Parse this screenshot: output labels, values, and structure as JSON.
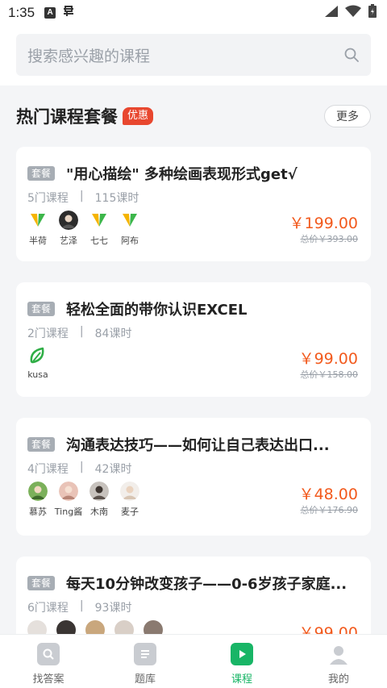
{
  "status_bar": {
    "time": "1:35",
    "a_icon_letter": "A"
  },
  "search": {
    "placeholder": "搜索感兴趣的课程"
  },
  "section": {
    "title": "热门课程套餐",
    "badge": "优惠",
    "more_label": "更多"
  },
  "colors": {
    "accent": "#18b566",
    "price": "#f25a1d",
    "hot_badge": "#e8472f",
    "tag": "#a7adb4"
  },
  "packages": [
    {
      "tag": "套餐",
      "title": "\"用心描绘\" 多种绘画表现形式get√",
      "course_count": "5门课程",
      "separator": "|",
      "hours": "115课时",
      "price": "￥199.00",
      "original_price": "总价￥393.00",
      "teachers": [
        {
          "name": "半荷",
          "icon": "leaf-logo-icon"
        },
        {
          "name": "艺泽",
          "icon": "avatar-photo"
        },
        {
          "name": "七七",
          "icon": "leaf-logo-icon"
        },
        {
          "name": "阿布",
          "icon": "leaf-logo-icon"
        }
      ]
    },
    {
      "tag": "套餐",
      "title": "轻松全面的带你认识EXCEL",
      "course_count": "2门课程",
      "separator": "|",
      "hours": "84课时",
      "price": "￥99.00",
      "original_price": "总价￥158.00",
      "teachers": [
        {
          "name": "kusa",
          "icon": "green-leaf-icon"
        }
      ]
    },
    {
      "tag": "套餐",
      "title": "沟通表达技巧——如何让自己表达出口...",
      "course_count": "4门课程",
      "separator": "|",
      "hours": "42课时",
      "price": "￥48.00",
      "original_price": "总价￥176.90",
      "teachers": [
        {
          "name": "慕苏",
          "icon": "avatar-photo"
        },
        {
          "name": "Ting酱",
          "icon": "avatar-photo"
        },
        {
          "name": "木南",
          "icon": "avatar-photo"
        },
        {
          "name": "麦子",
          "icon": "avatar-photo"
        }
      ]
    },
    {
      "tag": "套餐",
      "title": "每天10分钟改变孩子——0-6岁孩子家庭...",
      "course_count": "6门课程",
      "separator": "|",
      "hours": "93课时",
      "price": "￥99.00",
      "original_price": "",
      "teachers": []
    }
  ],
  "tabs": [
    {
      "label": "找答案",
      "icon": "search-answer-icon",
      "active": false
    },
    {
      "label": "题库",
      "icon": "question-bank-icon",
      "active": false
    },
    {
      "label": "课程",
      "icon": "course-play-icon",
      "active": true
    },
    {
      "label": "我的",
      "icon": "profile-icon",
      "active": false
    }
  ]
}
